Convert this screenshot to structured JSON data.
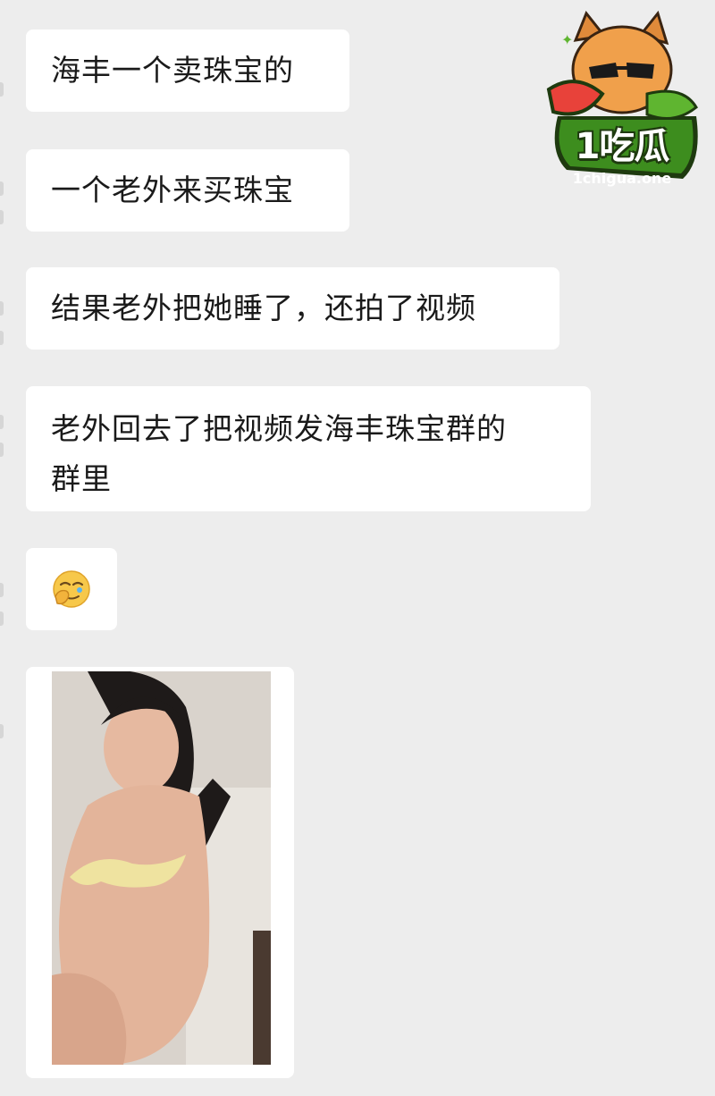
{
  "messages": [
    {
      "text": "海丰一个卖珠宝的"
    },
    {
      "text": "一个老外来买珠宝"
    },
    {
      "text": "结果老外把她睡了，还拍了视频"
    },
    {
      "line1": "老外回去了把视频发海丰珠宝群的",
      "line2": "群里"
    },
    {
      "emoji": "facepalm-emoji"
    },
    {
      "media": "photo-message"
    }
  ],
  "watermark": {
    "title": "1吃瓜",
    "domain": "1chigua.one"
  },
  "colors": {
    "background": "#ededed",
    "bubble": "#ffffff",
    "text": "#1a1a1a",
    "logo_green": "#2f7d17"
  }
}
